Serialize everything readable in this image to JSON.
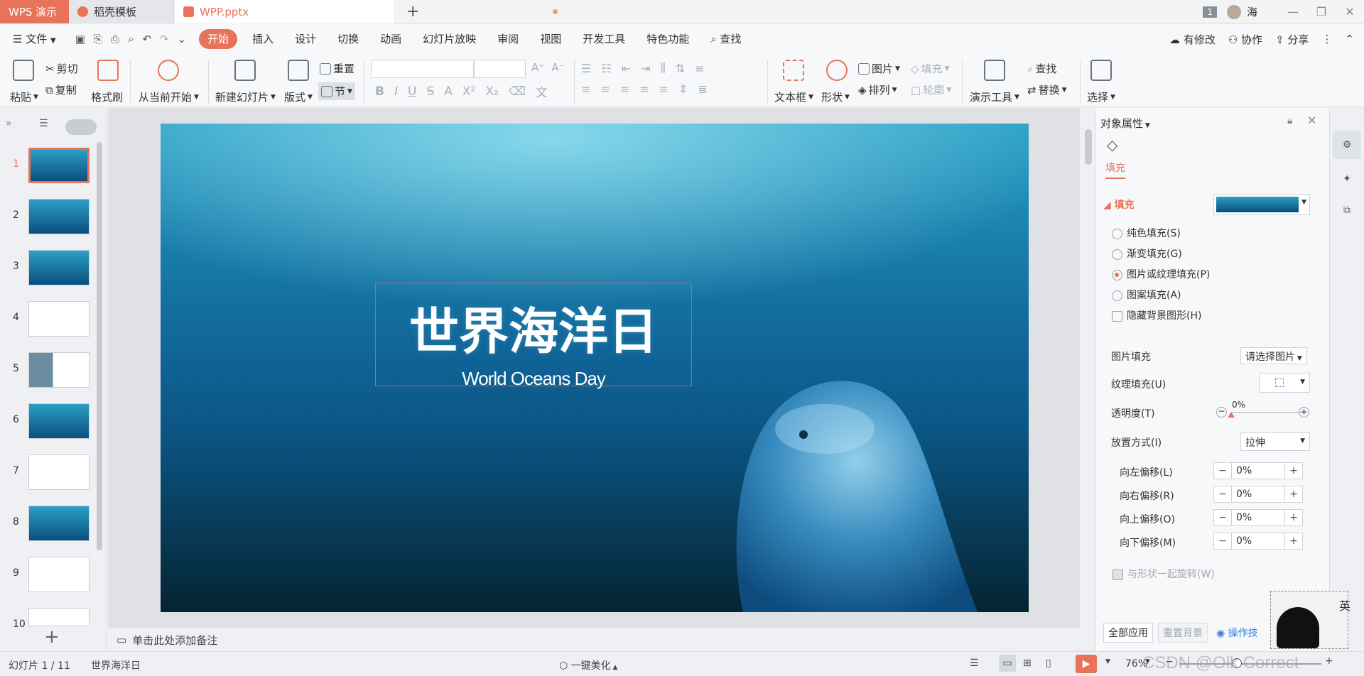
{
  "titlebar": {
    "app_tab": "WPS 演示",
    "template_tab": "稻壳模板",
    "file_tab": "WPP.pptx",
    "badge": "1",
    "user": "海"
  },
  "menu": {
    "file": "文件",
    "items": [
      "开始",
      "插入",
      "设计",
      "切换",
      "动画",
      "幻灯片放映",
      "审阅",
      "视图",
      "开发工具",
      "特色功能"
    ],
    "search": "查找",
    "right": [
      "有修改",
      "协作",
      "分享"
    ]
  },
  "ribbon": {
    "paste": "粘贴",
    "cut": "剪切",
    "copy": "复制",
    "format_painter": "格式刷",
    "from_current": "从当前开始",
    "new_slide": "新建幻灯片",
    "layout": "版式",
    "reset": "重置",
    "section": "节",
    "text_box": "文本框",
    "shape": "形状",
    "picture": "图片",
    "fill": "填充",
    "arrange": "排列",
    "outline": "轮廓",
    "presenter_tools": "演示工具",
    "find": "查找",
    "replace": "替换",
    "select": "选择"
  },
  "slides": {
    "numbers": [
      "1",
      "2",
      "3",
      "4",
      "5",
      "6",
      "7",
      "8",
      "9",
      "10"
    ],
    "current": 1
  },
  "slide": {
    "title": "世界海洋日",
    "subtitle": "World Oceans Day"
  },
  "notes_placeholder": "单击此处添加备注",
  "panel": {
    "title": "对象属性",
    "tab_fill": "填充",
    "section_fill": "填充",
    "options": [
      "纯色填充(S)",
      "渐变填充(G)",
      "图片或纹理填充(P)",
      "图案填充(A)"
    ],
    "selected_option": "图片或纹理填充(P)",
    "hide_bg": "隐藏背景图形(H)",
    "picture_fill_label": "图片填充",
    "picture_fill_value": "请选择图片",
    "texture_fill_label": "纹理填充(U)",
    "transparency_label": "透明度(T)",
    "transparency_value": "0%",
    "placement_label": "放置方式(I)",
    "placement_value": "拉伸",
    "offsets": [
      {
        "label": "向左偏移(L)",
        "value": "0%"
      },
      {
        "label": "向右偏移(R)",
        "value": "0%"
      },
      {
        "label": "向上偏移(O)",
        "value": "0%"
      },
      {
        "label": "向下偏移(M)",
        "value": "0%"
      }
    ],
    "rotate_with_shape": "与形状一起旋转(W)",
    "apply_all": "全部应用",
    "reset_bg": "重置背景",
    "tips": "操作技"
  },
  "status": {
    "slide_count": "幻灯片 1 / 11",
    "slide_name": "世界海洋日",
    "beautify": "一键美化",
    "zoom": "76%",
    "watermark": "CSDN @Olk Correct",
    "ime": "英"
  },
  "colors": {
    "accent": "#e8735a",
    "ocean_top": "#2aa0c6",
    "ocean_bottom": "#072f4c"
  }
}
